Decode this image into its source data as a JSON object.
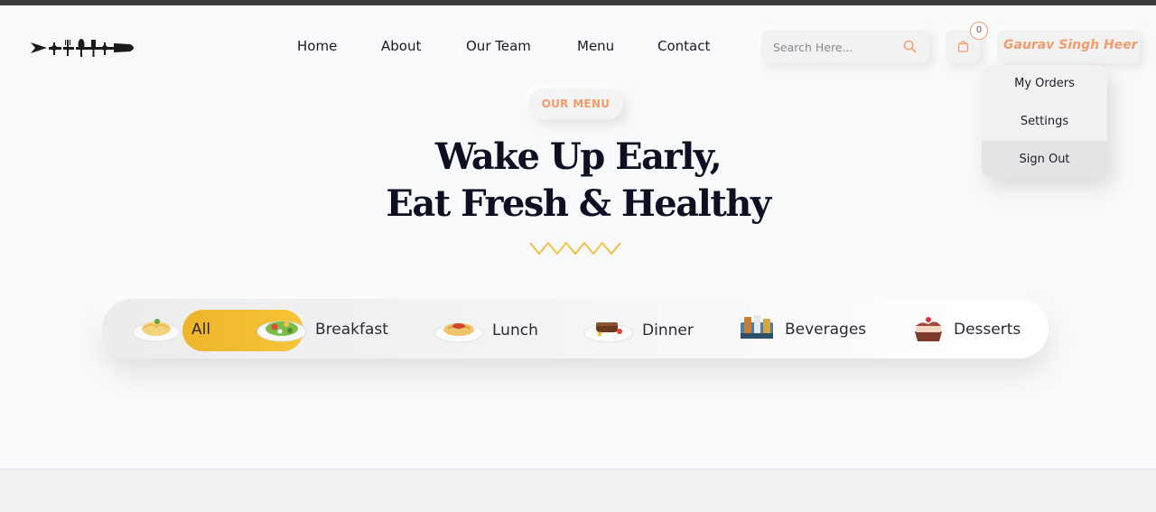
{
  "nav": {
    "items": [
      {
        "label": "Home"
      },
      {
        "label": "About"
      },
      {
        "label": "Our Team"
      },
      {
        "label": "Menu"
      },
      {
        "label": "Contact"
      }
    ]
  },
  "search": {
    "placeholder": "Search Here..."
  },
  "cart": {
    "count": "0"
  },
  "user": {
    "name": "Gaurav Singh Heer",
    "menu": [
      {
        "label": "My Orders"
      },
      {
        "label": "Settings"
      },
      {
        "label": "Sign Out"
      }
    ]
  },
  "hero": {
    "tag": "OUR MENU",
    "title_line1": "Wake Up Early,",
    "title_line2": "Eat Fresh & Healthy"
  },
  "categories": {
    "selected": "All",
    "items": [
      {
        "label": "All",
        "icon": "pasta-plate-icon"
      },
      {
        "label": "Breakfast",
        "icon": "salad-plate-icon"
      },
      {
        "label": "Lunch",
        "icon": "noodles-plate-icon"
      },
      {
        "label": "Dinner",
        "icon": "steak-plate-icon"
      },
      {
        "label": "Beverages",
        "icon": "drinks-icon"
      },
      {
        "label": "Desserts",
        "icon": "cake-icon"
      }
    ]
  },
  "colors": {
    "accent": "#f39c6b",
    "active_category": "#f2bd2f",
    "heading": "#0f0f24",
    "zigzag": "#f1c045"
  }
}
